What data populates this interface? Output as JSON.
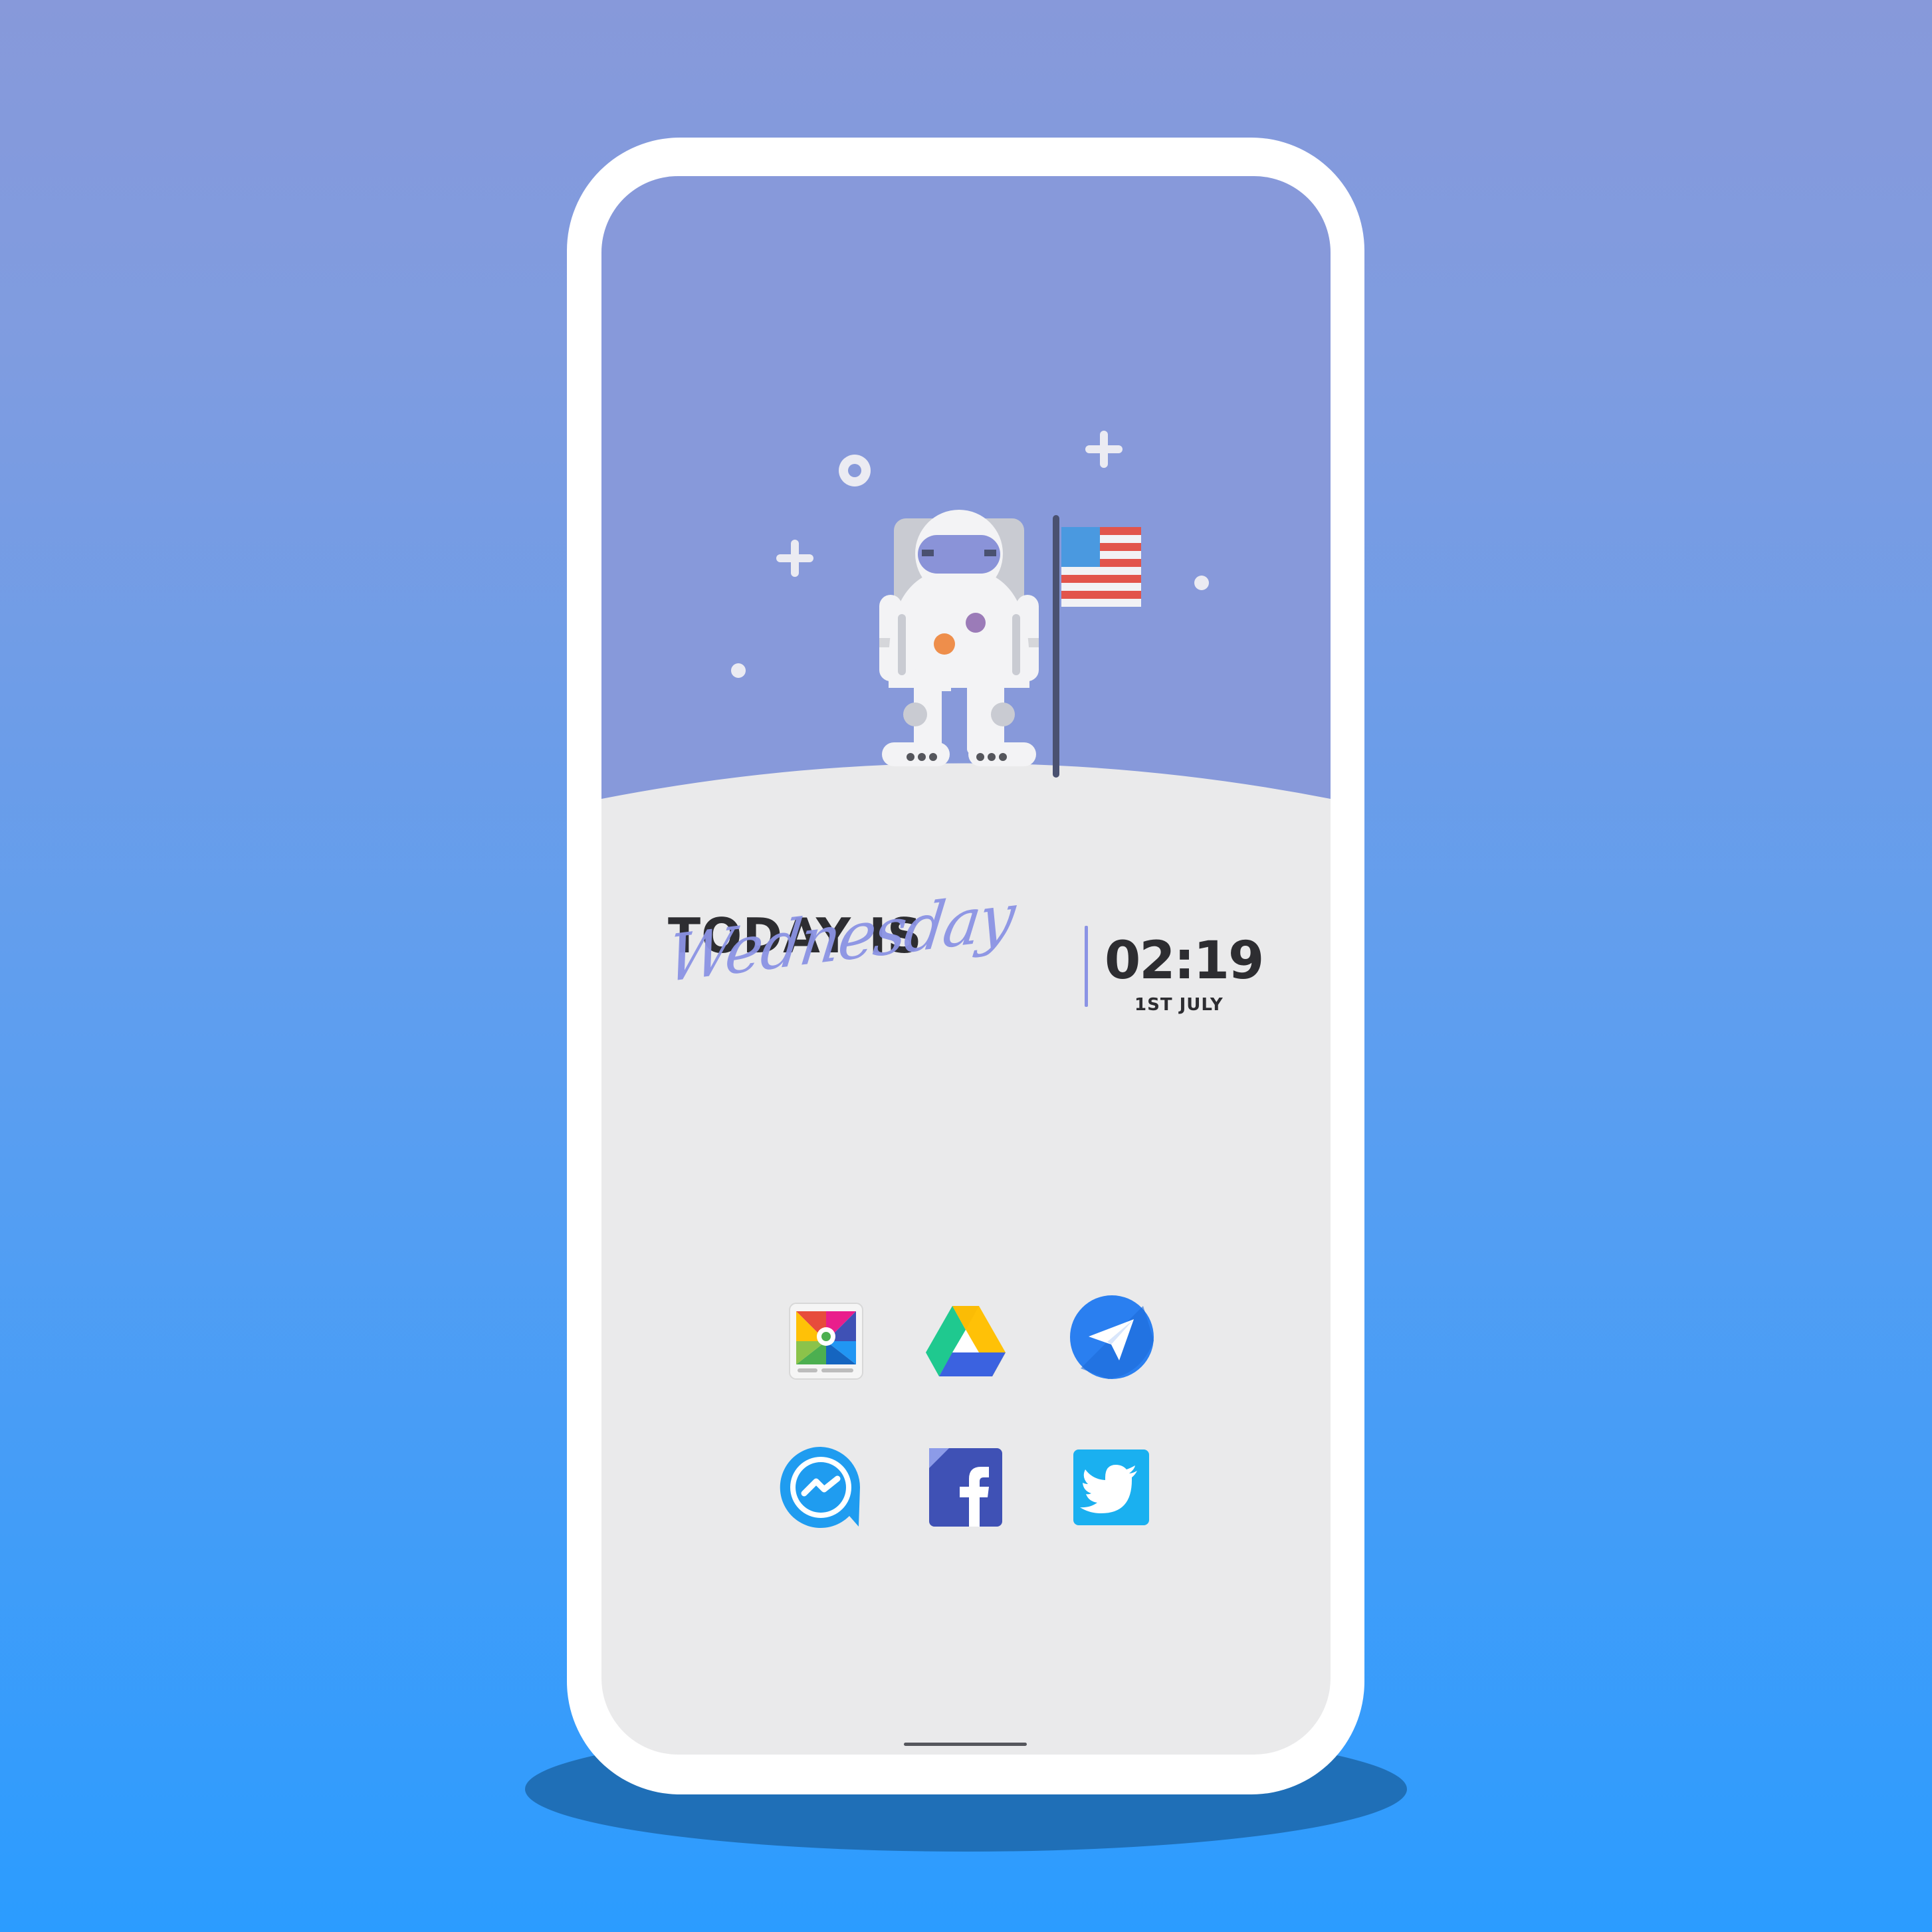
{
  "widgets": {
    "day": {
      "prefix": "TODAY IS",
      "weekday": "Wednesday"
    },
    "clock": {
      "time": "02:19",
      "date": "1ST JULY"
    }
  },
  "apps": [
    {
      "name": "gallery",
      "icon": "photo-gallery-icon"
    },
    {
      "name": "drive",
      "icon": "google-drive-icon"
    },
    {
      "name": "telegram",
      "icon": "paper-plane-icon"
    },
    {
      "name": "messenger",
      "icon": "messenger-icon"
    },
    {
      "name": "facebook",
      "icon": "facebook-icon"
    },
    {
      "name": "twitter",
      "icon": "twitter-bird-icon"
    }
  ],
  "colors": {
    "background_top": "#8799da",
    "background_bottom": "#2b9cff",
    "sky": "#8799da",
    "ground": "#eaeaeb",
    "accent": "#8b93e4",
    "text": "#2d2d31"
  }
}
